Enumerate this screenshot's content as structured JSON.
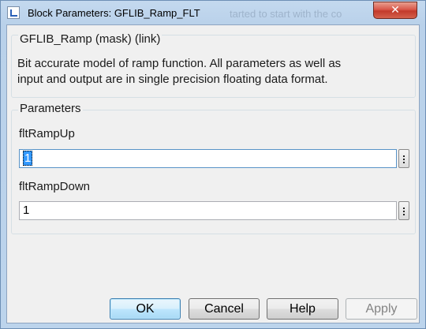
{
  "window": {
    "title": "Block Parameters: GFLIB_Ramp_FLT",
    "background_title_fragment": "tarted to start with the co",
    "close_glyph": "✕",
    "title_icon": "simulink-block-icon"
  },
  "mask": {
    "title": "GFLIB_Ramp (mask) (link)",
    "description_line1": "Bit accurate model of ramp function. All parameters as well as",
    "description_line2": "input and output are in single precision floating data format."
  },
  "parameters": {
    "group_title": "Parameters",
    "fields": [
      {
        "label": "fltRampUp",
        "value": "1",
        "selected": true,
        "menu_icon": "vertical-ellipsis-icon"
      },
      {
        "label": "fltRampDown",
        "value": "1",
        "selected": false,
        "menu_icon": "vertical-ellipsis-icon"
      }
    ]
  },
  "buttons": {
    "ok": "OK",
    "cancel": "Cancel",
    "help": "Help",
    "apply": "Apply",
    "apply_enabled": false
  },
  "colors": {
    "title_bar": "#bcd4ec",
    "close_button": "#c9463a",
    "dialog_background": "#f0f0f0",
    "selection": "#3399ff",
    "default_button_border": "#3c7fb1"
  }
}
